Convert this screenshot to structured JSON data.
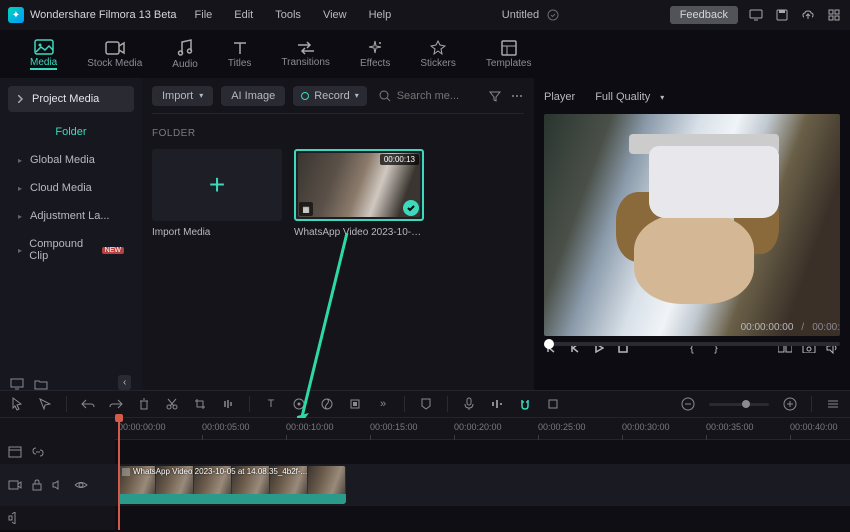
{
  "app": {
    "name": "Wondershare Filmora 13 Beta",
    "title": "Untitled"
  },
  "menu": [
    "File",
    "Edit",
    "Tools",
    "View",
    "Help"
  ],
  "topbar_actions": {
    "feedback": "Feedback"
  },
  "main_tabs": [
    {
      "label": "Media",
      "icon": "image"
    },
    {
      "label": "Stock Media",
      "icon": "video"
    },
    {
      "label": "Audio",
      "icon": "music"
    },
    {
      "label": "Titles",
      "icon": "text"
    },
    {
      "label": "Transitions",
      "icon": "swap"
    },
    {
      "label": "Effects",
      "icon": "sparkle"
    },
    {
      "label": "Stickers",
      "icon": "sticker"
    },
    {
      "label": "Templates",
      "icon": "layout"
    }
  ],
  "left_panel": {
    "header": "Project Media",
    "items": [
      "Folder",
      "Global Media",
      "Cloud Media",
      "Adjustment La...",
      "Compound Clip"
    ]
  },
  "center": {
    "import": "Import",
    "ai_image": "AI Image",
    "record": "Record",
    "search_placeholder": "Search me...",
    "folder_label": "FOLDER",
    "import_tile": "Import Media",
    "media_item": {
      "name": "WhatsApp Video 2023-10-05...",
      "duration": "00:00:13"
    }
  },
  "player": {
    "label": "Player",
    "quality": "Full Quality",
    "time_current": "00:00:00:00",
    "time_total": "00:00:"
  },
  "timeline": {
    "ticks": [
      "00:00:00:00",
      "00:00:05:00",
      "00:00:10:00",
      "00:00:15:00",
      "00:00:20:00",
      "00:00:25:00",
      "00:00:30:00",
      "00:00:35:00",
      "00:00:40:00"
    ],
    "clip_name": "WhatsApp Video 2023-10-05 at 14.08.35_4b2f-..."
  }
}
